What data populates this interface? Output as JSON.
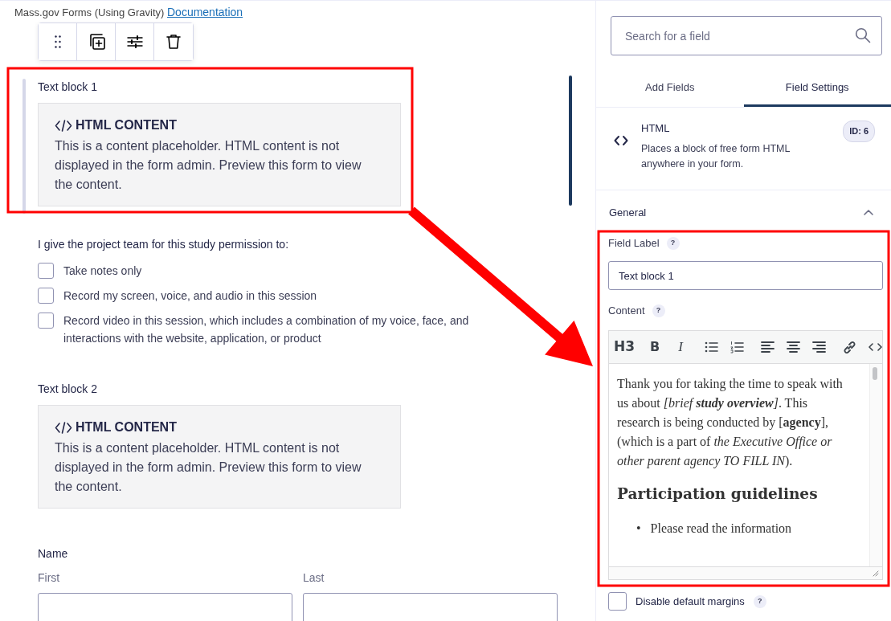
{
  "header": {
    "text": "Mass.gov Forms (Using Gravity)",
    "link": "Documentation"
  },
  "field_toolbar": [
    {
      "kind": "drag"
    },
    {
      "kind": "duplicate"
    },
    {
      "kind": "settings"
    },
    {
      "kind": "delete"
    }
  ],
  "fields": [
    {
      "kind": "html",
      "label": "Text block 1",
      "selected": true,
      "heading": "HTML CONTENT",
      "body": "This is a content placeholder. HTML content is not displayed in the form admin. Preview this form to view the content."
    },
    {
      "kind": "checkboxes",
      "label": "I give the project team for this study permission to:",
      "selected": false,
      "options": [
        {
          "label": "Take notes only",
          "checked": false
        },
        {
          "label": "Record my screen, voice, and audio in this session",
          "checked": false
        },
        {
          "label": "Record video in this session, which includes a combination of my voice, face, and interactions with the website, application, or product",
          "checked": false
        }
      ]
    },
    {
      "kind": "html",
      "label": "Text block 2",
      "selected": false,
      "heading": "HTML CONTENT",
      "body": "This is a content placeholder. HTML content is not displayed in the form admin. Preview this form to view the content."
    },
    {
      "kind": "name",
      "label": "Name",
      "selected": false,
      "sublabels": [
        "First",
        "Last"
      ]
    }
  ],
  "sidebar": {
    "search": {
      "placeholder": "Search for a field"
    },
    "tabs": [
      {
        "label": "Add Fields",
        "selected": false
      },
      {
        "label": "Field Settings",
        "selected": true
      }
    ],
    "field_info": {
      "title": "HTML",
      "description": "Places a block of free form HTML anywhere in your form.",
      "id_badge": "ID: 6"
    },
    "section": {
      "title": "General",
      "expanded": true
    },
    "field_label": {
      "label": "Field Label",
      "help": "?",
      "value": "Text block 1"
    },
    "content": {
      "label": "Content",
      "help": "?",
      "toolbar": [
        {
          "kind": "h3",
          "text": "H3"
        },
        {
          "kind": "bold",
          "text": "B"
        },
        {
          "kind": "italic",
          "text": "I"
        },
        {
          "kind": "bullets"
        },
        {
          "kind": "numbers"
        },
        {
          "kind": "align-left"
        },
        {
          "kind": "align-center"
        },
        {
          "kind": "align-right"
        },
        {
          "kind": "link"
        },
        {
          "kind": "code"
        }
      ],
      "paragraph": [
        {
          "text": "Thank you for taking the time to speak with us about ",
          "bold": false,
          "italic": false
        },
        {
          "text": "[brief ",
          "bold": false,
          "italic": true
        },
        {
          "text": "study overview",
          "bold": true,
          "italic": true
        },
        {
          "text": "]",
          "bold": false,
          "italic": true
        },
        {
          "text": ". This research is being conducted by [",
          "bold": false,
          "italic": false
        },
        {
          "text": "agency",
          "bold": true,
          "italic": false
        },
        {
          "text": "], (which is a part of ",
          "bold": false,
          "italic": false
        },
        {
          "text": "the Executive Office or other parent agency TO FILL IN",
          "bold": false,
          "italic": true
        },
        {
          "text": ").",
          "bold": false,
          "italic": false
        }
      ],
      "heading": "Participation guidelines",
      "bullets": [
        {
          "marker": "•",
          "text": "Please read the information"
        }
      ]
    },
    "disable_margins": {
      "label": "Disable default margins",
      "checked": false,
      "help": "?"
    }
  }
}
